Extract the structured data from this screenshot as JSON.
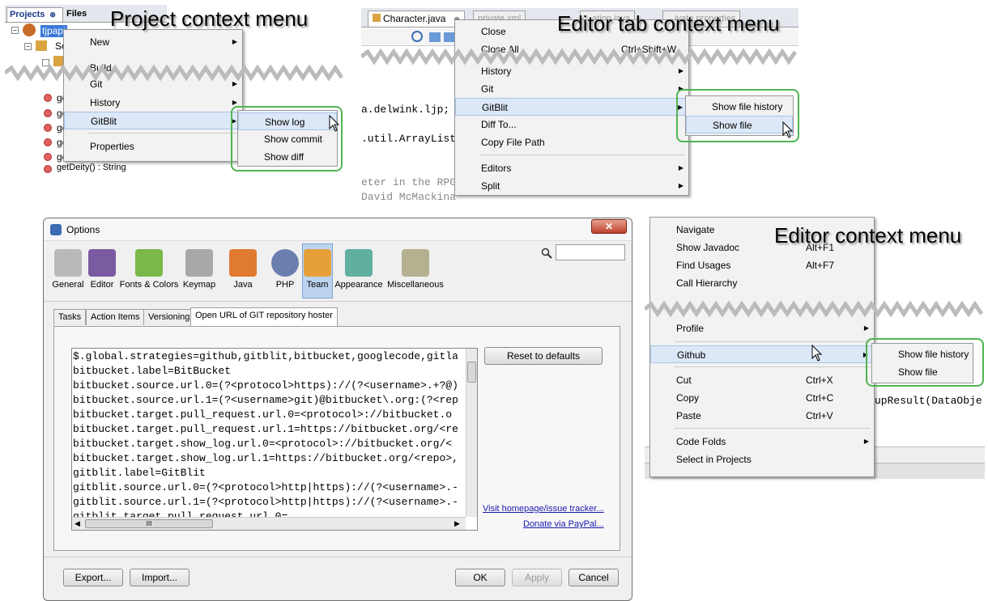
{
  "captions": {
    "project": "Project context menu",
    "tab": "Editor tab context menu",
    "editor": "Editor context menu"
  },
  "project": {
    "tabs": [
      "Projects",
      "Files"
    ],
    "root": "tjpapi",
    "tree_partial": [
      "So",
      "ge",
      "ge",
      "ge",
      "ge",
      "ge"
    ],
    "last_row": "getDeity() : String",
    "menu": [
      {
        "label": "New",
        "arrow": "▶"
      },
      {
        "label": "Build"
      },
      {
        "label": "Git",
        "arrow": "▶"
      },
      {
        "label": "History",
        "arrow": "▶"
      },
      {
        "label": "GitBlit",
        "arrow": "▶"
      },
      {
        "label": "Properties"
      }
    ],
    "submenu": [
      "Show log",
      "Show commit",
      "Show diff"
    ]
  },
  "tabctx": {
    "tabs": [
      "Character.java",
      "private.xml",
      "...ation.java",
      "...ivate.properties"
    ],
    "code_fragments": [
      "a.delwink.ljp;",
      ".util.ArrayList",
      "eter in the RPG",
      "David McMackina"
    ],
    "menu": [
      {
        "label": "Close"
      },
      {
        "label": "Close All",
        "acc": "Ctrl+Shift+W"
      },
      {
        "label": "History",
        "arrow": "▶"
      },
      {
        "label": "Git",
        "arrow": "▶"
      },
      {
        "label": "GitBlit",
        "arrow": "▶"
      },
      {
        "label": "Diff To..."
      },
      {
        "label": "Copy File Path"
      },
      {
        "label": "Editors",
        "arrow": "▶"
      },
      {
        "label": "Split",
        "arrow": "▶"
      }
    ],
    "submenu": [
      "Show file history",
      "Show file"
    ]
  },
  "editorctx": {
    "code_fragment": "upResult(DataObje",
    "menu": [
      {
        "label": "Navigate"
      },
      {
        "label": "Show Javadoc",
        "acc": "Alt+F1"
      },
      {
        "label": "Find Usages",
        "acc": "Alt+F7"
      },
      {
        "label": "Call Hierarchy"
      },
      {
        "label": "Profile",
        "arrow": "▶"
      },
      {
        "label": "Github",
        "arrow": "▶"
      },
      {
        "label": "Cut",
        "acc": "Ctrl+X"
      },
      {
        "label": "Copy",
        "acc": "Ctrl+C"
      },
      {
        "label": "Paste",
        "acc": "Ctrl+V"
      },
      {
        "label": "Code Folds",
        "arrow": "▶"
      },
      {
        "label": "Select in Projects"
      }
    ],
    "submenu": [
      "Show file history",
      "Show file"
    ]
  },
  "options": {
    "title": "Options",
    "close": "✕",
    "search_placeholder": "",
    "toolbar": [
      "General",
      "Editor",
      "Fonts & Colors",
      "Keymap",
      "Java",
      "PHP",
      "Team",
      "Appearance",
      "Miscellaneous"
    ],
    "tabs": [
      "Tasks",
      "Action Items",
      "Versioning",
      "Open URL of GIT repository hoster"
    ],
    "code_lines": [
      "$.global.strategies=github,gitblit,bitbucket,googlecode,gitla",
      "bitbucket.label=BitBucket",
      "bitbucket.source.url.0=(?<protocol>https)://(?<username>.+?@)",
      "bitbucket.source.url.1=(?<username>git)@bitbucket\\.org:(?<rep",
      "bitbucket.target.pull_request.url.0=<protocol>://bitbucket.o",
      "bitbucket.target.pull_request.url.1=https://bitbucket.org/<re",
      "bitbucket.target.show_log.url.0=<protocol>://bitbucket.org/<",
      "bitbucket.target.show_log.url.1=https://bitbucket.org/<repo>,",
      "gitblit.label=GitBlit",
      "gitblit.source.url.0=(?<protocol>http|https)://(?<username>.-",
      "gitblit.source.url.1=(?<protocol>http|https)://(?<username>.-",
      "gitblit.target.pull_request.url.0="
    ],
    "scroll_grip": "III",
    "reset": "Reset to defaults",
    "visit": "Visit homepage/issue tracker...",
    "donate": "Donate via PayPal...",
    "buttons": {
      "export": "Export...",
      "import": "Import...",
      "ok": "OK",
      "apply": "Apply",
      "cancel": "Cancel"
    }
  }
}
